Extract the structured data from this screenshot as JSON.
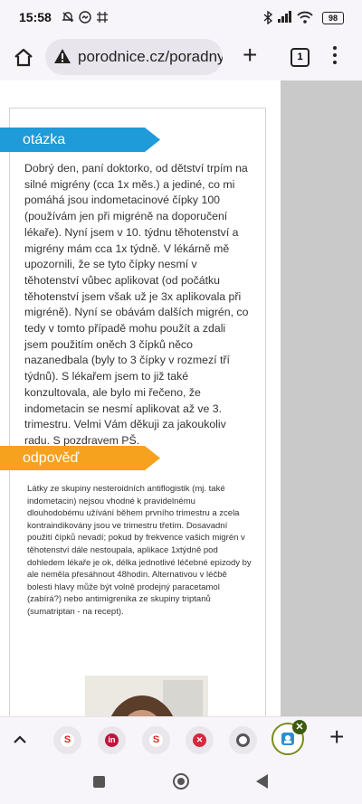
{
  "status_bar": {
    "time": "15:58",
    "battery": "98"
  },
  "browser": {
    "url": "porodnice.cz/poradny",
    "tab_count": "1"
  },
  "article": {
    "question_label": "otázka",
    "question_text": "Dobrý den, paní doktorko, od dětství trpím na silné migrény (cca 1x měs.) a jediné, co mi pomáhá jsou indometacinové čípky 100 (používám jen při migréně na doporučení lékaře). Nyní jsem v 10. týdnu těhotenství a migrény mám cca 1x týdně. V lékárně mě upozornili, že se tyto čípky nesmí v těhotenství vůbec aplikovat (od počátku těhotenství jsem však už je 3x aplikovala při migréně). Nyní se obávám dalších migrén, co tedy v tomto případě mohu použít a zdali jsem použitím oněch 3 čípků něco nazanedbala (byly to 3 čípky v rozmezí tří týdnů). S lékařem jsem to již také konzultovala, ale bylo mi řečeno, že indometacin se nesmí aplikovat až ve 3. trimestru. Velmi Vám děkuji za jakoukoliv radu. S pozdravem PŠ.",
    "answer_label": "odpověď",
    "answer_text": "Látky ze skupiny nesteroidních antiflogistik (mj. také indometacin) nejsou vhodné k pravidelnému dlouhodobému užívání během prvního trimestru a zcela kontraindikovány jsou ve trimestru třetím. Dosavadní použití čípků nevadí; pokud by frekvence vašich migrén v těhotenství dále nestoupala, aplikace 1xtýdně pod dohledem lékaře je ok, délka jednotlivé léčebné epizody by ale neměla přesáhnout 48hodin. Alternativou v léčbě bolesti hlavy může být volně prodejný paracetamol (zabírá?) nebo antimigrenika ze skupiny triptanů (sumatriptan - na recept)."
  },
  "tab_strip": {
    "tabs": [
      {
        "icon": "seznam-icon",
        "glyph": "S",
        "color": "#d52b1e"
      },
      {
        "icon": "linkedin-icon",
        "glyph": "in",
        "color": "#c0143c"
      },
      {
        "icon": "seznam-icon",
        "glyph": "S",
        "color": "#d52b1e"
      },
      {
        "icon": "close-circle-icon",
        "glyph": "✕",
        "color": "#d7263d"
      },
      {
        "icon": "chrome-icon",
        "glyph": "",
        "color": "#555555"
      }
    ]
  }
}
